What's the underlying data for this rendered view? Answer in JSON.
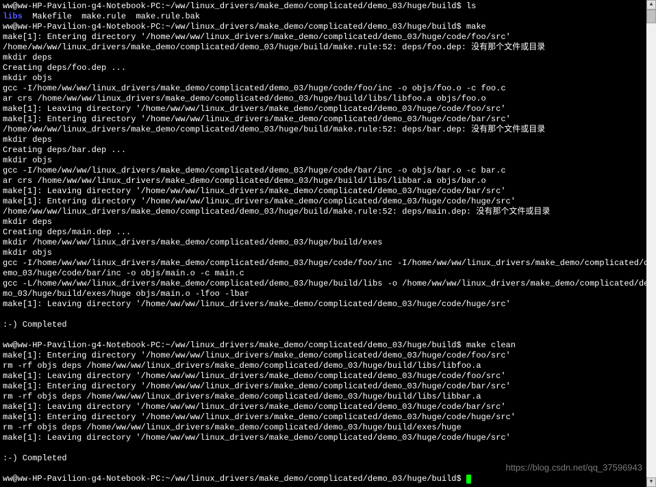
{
  "terminal": {
    "lines": [
      {
        "type": "prompt",
        "text": "ww@ww-HP-Pavilion-g4-Notebook-PC:~/ww/linux_drivers/make_demo/complicated/demo_03/huge/build$ ls"
      },
      {
        "type": "ls",
        "libs": "libs",
        "rest": "  Makefile  make.rule  make.rule.bak"
      },
      {
        "type": "prompt",
        "text": "ww@ww-HP-Pavilion-g4-Notebook-PC:~/ww/linux_drivers/make_demo/complicated/demo_03/huge/build$ make"
      },
      {
        "type": "output",
        "text": "make[1]: Entering directory '/home/ww/ww/linux_drivers/make_demo/complicated/demo_03/huge/code/foo/src'"
      },
      {
        "type": "output",
        "text": "/home/ww/ww/linux_drivers/make_demo/complicated/demo_03/huge/build/make.rule:52: deps/foo.dep: 没有那个文件或目录"
      },
      {
        "type": "output",
        "text": "mkdir deps"
      },
      {
        "type": "output",
        "text": "Creating deps/foo.dep ..."
      },
      {
        "type": "output",
        "text": "mkdir objs"
      },
      {
        "type": "output",
        "text": "gcc -I/home/ww/ww/linux_drivers/make_demo/complicated/demo_03/huge/code/foo/inc -o objs/foo.o -c foo.c"
      },
      {
        "type": "output",
        "text": "ar crs /home/ww/ww/linux_drivers/make_demo/complicated/demo_03/huge/build/libs/libfoo.a objs/foo.o"
      },
      {
        "type": "output",
        "text": "make[1]: Leaving directory '/home/ww/ww/linux_drivers/make_demo/complicated/demo_03/huge/code/foo/src'"
      },
      {
        "type": "output",
        "text": "make[1]: Entering directory '/home/ww/ww/linux_drivers/make_demo/complicated/demo_03/huge/code/bar/src'"
      },
      {
        "type": "output",
        "text": "/home/ww/ww/linux_drivers/make_demo/complicated/demo_03/huge/build/make.rule:52: deps/bar.dep: 没有那个文件或目录"
      },
      {
        "type": "output",
        "text": "mkdir deps"
      },
      {
        "type": "output",
        "text": "Creating deps/bar.dep ..."
      },
      {
        "type": "output",
        "text": "mkdir objs"
      },
      {
        "type": "output",
        "text": "gcc -I/home/ww/ww/linux_drivers/make_demo/complicated/demo_03/huge/code/bar/inc -o objs/bar.o -c bar.c"
      },
      {
        "type": "output",
        "text": "ar crs /home/ww/ww/linux_drivers/make_demo/complicated/demo_03/huge/build/libs/libbar.a objs/bar.o"
      },
      {
        "type": "output",
        "text": "make[1]: Leaving directory '/home/ww/ww/linux_drivers/make_demo/complicated/demo_03/huge/code/bar/src'"
      },
      {
        "type": "output",
        "text": "make[1]: Entering directory '/home/ww/ww/linux_drivers/make_demo/complicated/demo_03/huge/code/huge/src'"
      },
      {
        "type": "output",
        "text": "/home/ww/ww/linux_drivers/make_demo/complicated/demo_03/huge/build/make.rule:52: deps/main.dep: 没有那个文件或目录"
      },
      {
        "type": "output",
        "text": "mkdir deps"
      },
      {
        "type": "output",
        "text": "Creating deps/main.dep ..."
      },
      {
        "type": "output",
        "text": "mkdir /home/ww/ww/linux_drivers/make_demo/complicated/demo_03/huge/build/exes"
      },
      {
        "type": "output",
        "text": "mkdir objs"
      },
      {
        "type": "output",
        "text": "gcc -I/home/ww/ww/linux_drivers/make_demo/complicated/demo_03/huge/code/foo/inc -I/home/ww/ww/linux_drivers/make_demo/complicated/demo_03/huge/code/bar/inc -o objs/main.o -c main.c"
      },
      {
        "type": "output",
        "text": "gcc -L/home/ww/ww/linux_drivers/make_demo/complicated/demo_03/huge/build/libs -o /home/ww/ww/linux_drivers/make_demo/complicated/demo_03/huge/build/exes/huge objs/main.o -lfoo -lbar"
      },
      {
        "type": "output",
        "text": "make[1]: Leaving directory '/home/ww/ww/linux_drivers/make_demo/complicated/demo_03/huge/code/huge/src'"
      },
      {
        "type": "output",
        "text": ""
      },
      {
        "type": "output",
        "text": ":-) Completed"
      },
      {
        "type": "output",
        "text": ""
      },
      {
        "type": "prompt",
        "text": "ww@ww-HP-Pavilion-g4-Notebook-PC:~/ww/linux_drivers/make_demo/complicated/demo_03/huge/build$ make clean"
      },
      {
        "type": "output",
        "text": "make[1]: Entering directory '/home/ww/ww/linux_drivers/make_demo/complicated/demo_03/huge/code/foo/src'"
      },
      {
        "type": "output",
        "text": "rm -rf objs deps /home/ww/ww/linux_drivers/make_demo/complicated/demo_03/huge/build/libs/libfoo.a"
      },
      {
        "type": "output",
        "text": "make[1]: Leaving directory '/home/ww/ww/linux_drivers/make_demo/complicated/demo_03/huge/code/foo/src'"
      },
      {
        "type": "output",
        "text": "make[1]: Entering directory '/home/ww/ww/linux_drivers/make_demo/complicated/demo_03/huge/code/bar/src'"
      },
      {
        "type": "output",
        "text": "rm -rf objs deps /home/ww/ww/linux_drivers/make_demo/complicated/demo_03/huge/build/libs/libbar.a"
      },
      {
        "type": "output",
        "text": "make[1]: Leaving directory '/home/ww/ww/linux_drivers/make_demo/complicated/demo_03/huge/code/bar/src'"
      },
      {
        "type": "output",
        "text": "make[1]: Entering directory '/home/ww/ww/linux_drivers/make_demo/complicated/demo_03/huge/code/huge/src'"
      },
      {
        "type": "output",
        "text": "rm -rf objs deps /home/ww/ww/linux_drivers/make_demo/complicated/demo_03/huge/build/exes/huge"
      },
      {
        "type": "output",
        "text": "make[1]: Leaving directory '/home/ww/ww/linux_drivers/make_demo/complicated/demo_03/huge/code/huge/src'"
      },
      {
        "type": "output",
        "text": ""
      },
      {
        "type": "output",
        "text": ":-) Completed"
      },
      {
        "type": "output",
        "text": ""
      },
      {
        "type": "prompt-cursor",
        "text": "ww@ww-HP-Pavilion-g4-Notebook-PC:~/ww/linux_drivers/make_demo/complicated/demo_03/huge/build$ "
      }
    ]
  },
  "watermark": "https://blog.csdn.net/qq_37596943"
}
